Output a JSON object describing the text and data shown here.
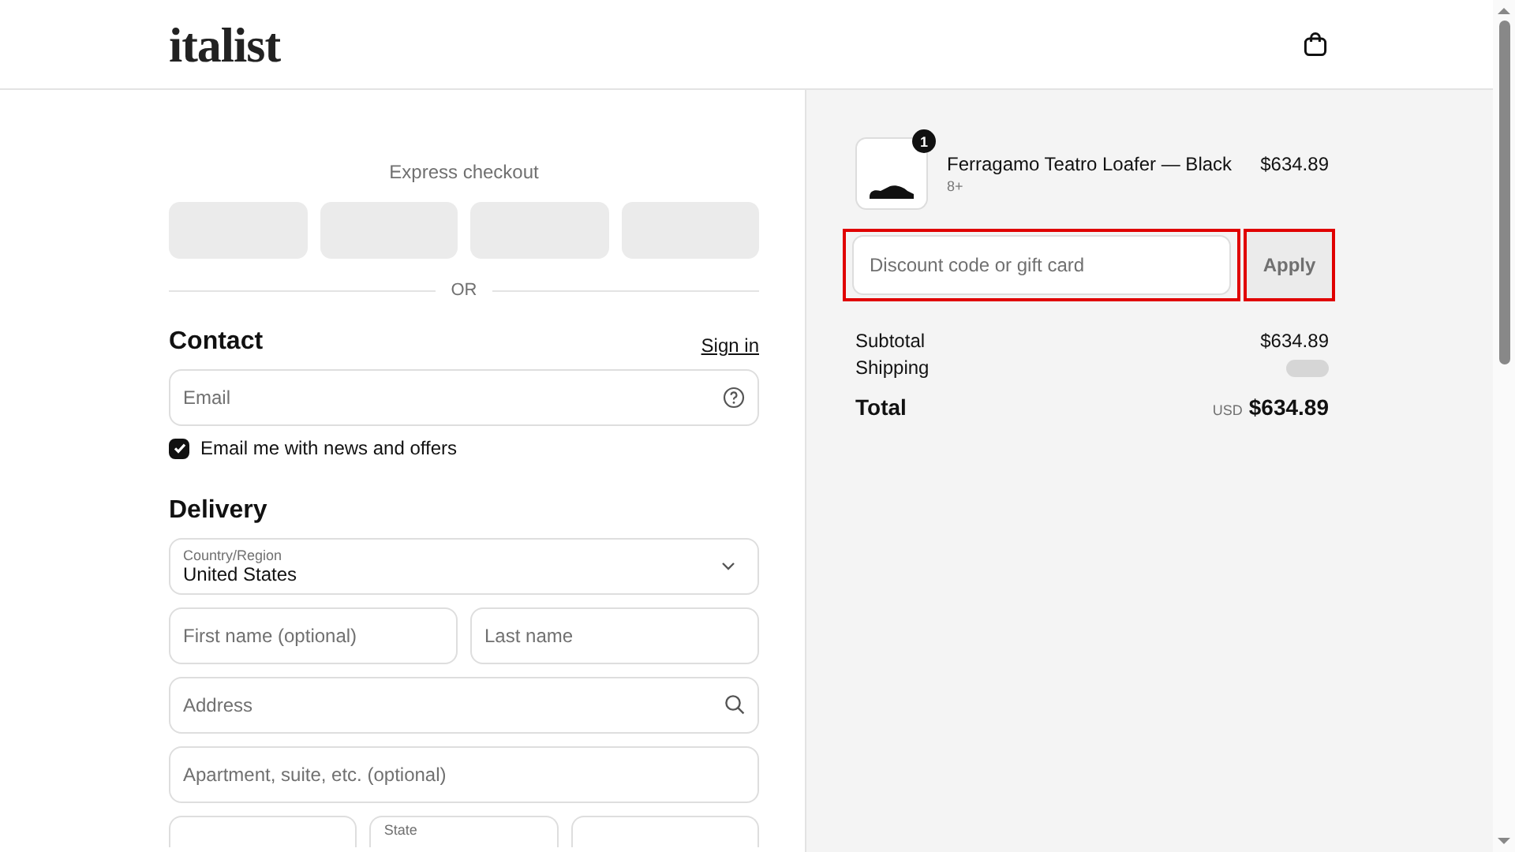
{
  "header": {
    "logo": "italist"
  },
  "express_checkout": {
    "title": "Express checkout",
    "divider": "OR"
  },
  "contact": {
    "title": "Contact",
    "sign_in": "Sign in",
    "email": {
      "placeholder": "Email"
    },
    "newsletter": {
      "label": "Email me with news and offers",
      "checked": true
    }
  },
  "delivery": {
    "title": "Delivery",
    "country": {
      "label": "Country/Region",
      "value": "United States"
    },
    "first_name": {
      "placeholder": "First name (optional)"
    },
    "last_name": {
      "placeholder": "Last name"
    },
    "address": {
      "placeholder": "Address"
    },
    "apartment": {
      "placeholder": "Apartment, suite, etc. (optional)"
    },
    "state": {
      "label": "State"
    }
  },
  "summary": {
    "item": {
      "name": "Ferragamo Teatro Loafer — Black",
      "variant": "8+",
      "price": "$634.89",
      "quantity": "1"
    },
    "discount": {
      "placeholder": "Discount code or gift card",
      "highlighted": true
    },
    "apply": {
      "label": "Apply",
      "highlighted": true
    },
    "subtotal": {
      "label": "Subtotal",
      "value": "$634.89"
    },
    "shipping": {
      "label": "Shipping"
    },
    "total": {
      "label": "Total",
      "currency": "USD",
      "value": "$634.89"
    }
  }
}
